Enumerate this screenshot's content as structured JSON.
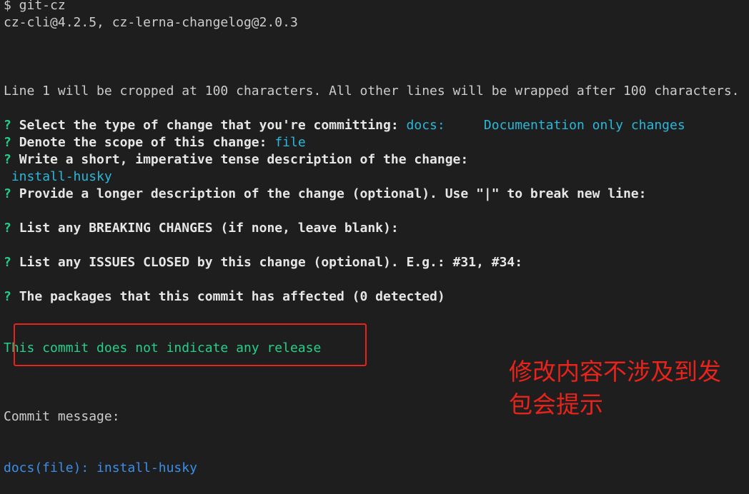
{
  "terminal": {
    "command": "$ git-cz",
    "version": "cz-cli@4.2.5, cz-lerna-changelog@2.0.3",
    "info": "Line 1 will be cropped at 100 characters. All other lines will be wrapped after 100 characters.",
    "prompt_mark": "?",
    "questions": [
      {
        "text": "Select the type of change that you're committing:",
        "answer": "docs:",
        "answer_extra": "Documentation only changes"
      },
      {
        "text": "Denote the scope of this change:",
        "answer": "file"
      },
      {
        "text": "Write a short, imperative tense description of the change:",
        "answer": "install-husky"
      },
      {
        "text": "Provide a longer description of the change (optional). Use \"|\" to break new line:"
      },
      {
        "text": "List any BREAKING CHANGES (if none, leave blank):"
      },
      {
        "text": "List any ISSUES CLOSED by this change (optional). E.g.: #31, #34:"
      },
      {
        "text": "The packages that this commit has affected (0 detected)"
      }
    ],
    "release_notice": "This commit does not indicate any release",
    "commit_label": "Commit message:",
    "commit_message": "docs(file): install-husky"
  },
  "annotation": {
    "text": "修改内容不涉及到发\n包会提示",
    "color": "#e8231c"
  },
  "colors": {
    "background": "#1e1e1e",
    "prompt": "#23d18b",
    "answer": "#29b8db",
    "commit": "#3b8eea"
  }
}
